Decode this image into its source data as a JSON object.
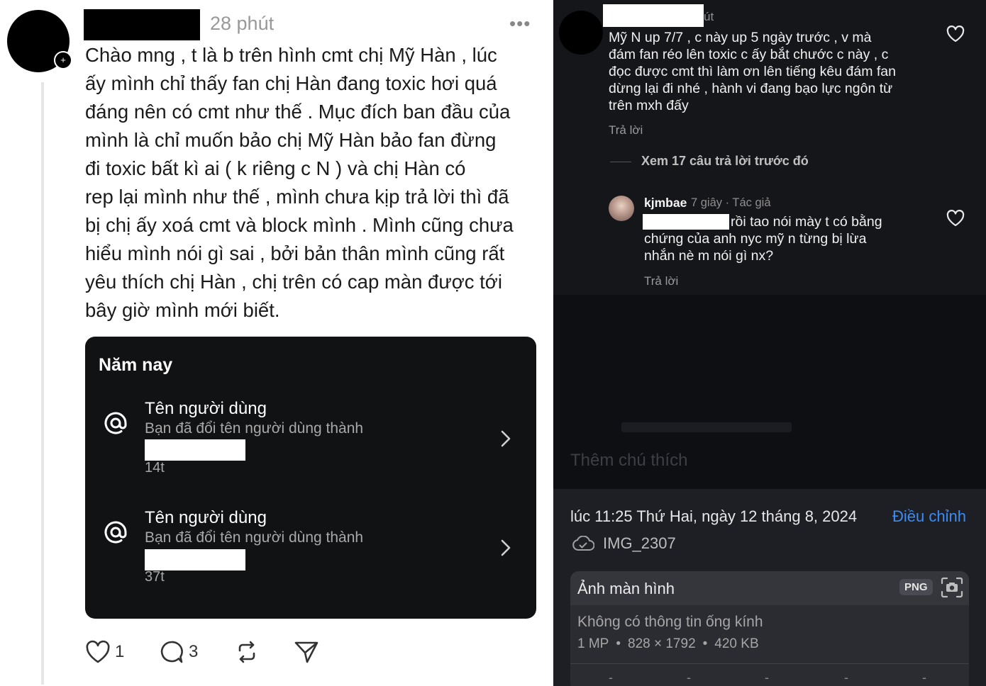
{
  "left": {
    "post_time": "28 phút",
    "more": "•••",
    "post_lines": [
      "Chào mng , t là b trên hình cmt chị Mỹ Hàn , lúc",
      "ấy mình chỉ thấy fan chị Hàn đang toxic hơi quá",
      "đáng nên có cmt như thế . Mục đích ban đầu của",
      "mình là chỉ muốn bảo chị Mỹ Hàn bảo fan đừng",
      "đi toxic bất kì ai ( k riêng c N      ) và chị Hàn có",
      "rep lại mình như thế , mình chưa kịp trả lời thì đã",
      "bị chị ấy xoá cmt và block mình . Mình cũng chưa",
      "hiểu mình nói gì sai , bởi bản thân mình cũng rất",
      "yêu thích chị Hàn , chị trên có cap màn được tới",
      "bây giờ mình mới biết."
    ],
    "card": {
      "title": "Năm nay",
      "entries": [
        {
          "title": "Tên người dùng",
          "sub": "Bạn đã đổi tên người dùng thành",
          "time": "14t"
        },
        {
          "title": "Tên người dùng",
          "sub": "Bạn đã đổi tên người dùng thành",
          "time": "37t"
        }
      ]
    },
    "actions": {
      "like_count": "1",
      "comment_count": "3"
    }
  },
  "right": {
    "time_fragment": "út",
    "comment_lines": [
      "Mỹ N      up 7/7 , c này up 5 ngày trước , v mà",
      "đám fan réo lên toxic c ấy bắt chước c này , c",
      "đọc được cmt thì làm ơn lên tiếng kêu đám fan",
      "dừng lại đi nhé , hành vi đang bạo lực ngôn từ",
      "trên mxh đấy"
    ],
    "reply_label": "Trả lời",
    "view_previous": "Xem 17 câu trả lời trước đó",
    "reply": {
      "author": "kjmbae",
      "meta": "7 giây · Tác giả",
      "lines": [
        "rồi tao nói mày t có bằng",
        "chứng của anh nyc mỹ n       từng bị lừa",
        "nhắn nè m nói gì nx?"
      ],
      "reply_label": "Trả lời"
    },
    "caption_placeholder": "Thêm chú thích",
    "info": {
      "date": "lúc 11:25 Thứ Hai, ngày 12 tháng 8, 2024",
      "adjust": "Điều chỉnh",
      "file_name": "IMG_2307",
      "box_title": "Ảnh màn hình",
      "format": "PNG",
      "lens": "Không có thông tin ống kính",
      "mp": "1 MP",
      "dims": "828 × 1792",
      "size": "420 KB",
      "sep": "•",
      "dash": "-"
    }
  },
  "colors": {
    "accent_blue": "#3b8cf3",
    "dark_bg": "#0e0f12"
  }
}
